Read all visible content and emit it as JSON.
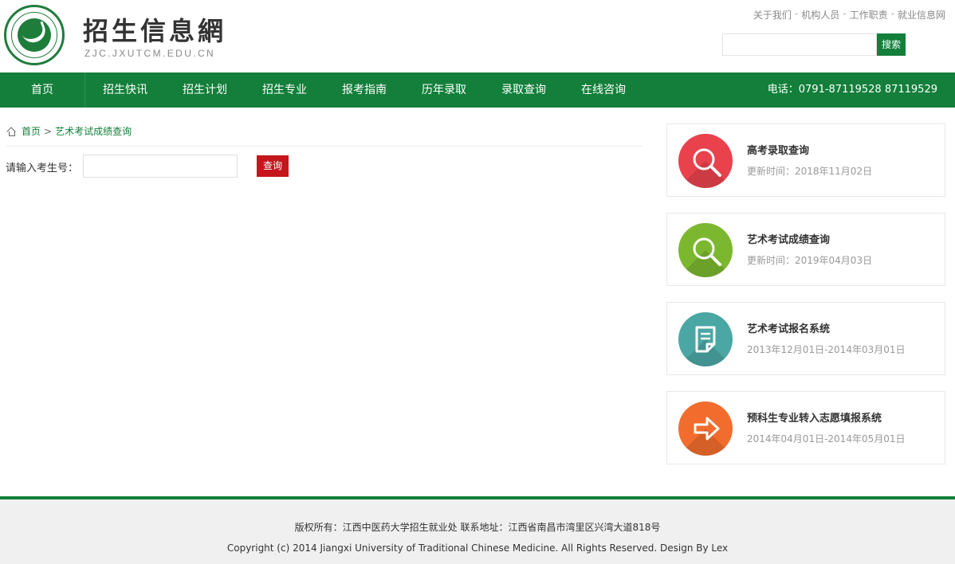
{
  "header": {
    "title": "招生信息網",
    "subtitle": "ZJC.JXUTCM.EDU.CN",
    "top_links": [
      "关于我们",
      "机构人员",
      "工作职责",
      "就业信息网"
    ],
    "top_links_sep": "-",
    "search_button": "搜索"
  },
  "nav": {
    "items": [
      "首页",
      "招生快讯",
      "招生计划",
      "招生专业",
      "报考指南",
      "历年录取",
      "录取查询",
      "在线咨询"
    ],
    "phone": "电话：0791-87119528 87119529"
  },
  "breadcrumb": {
    "home": "首页",
    "sep": ">",
    "current": "艺术考试成绩查询"
  },
  "query": {
    "label": "请输入考生号：",
    "button": "查询",
    "value": ""
  },
  "cards": [
    {
      "title": "高考录取查询",
      "date": "更新时间：2018年11月02日",
      "color": "#e9424d",
      "icon": "search-icon"
    },
    {
      "title": "艺术考试成绩查询",
      "date": "更新时间：2019年04月03日",
      "color": "#7cb82f",
      "icon": "search-icon"
    },
    {
      "title": "艺术考试报名系统",
      "date": "2013年12月01日-2014年03月01日",
      "color": "#4aa7a4",
      "icon": "document-icon"
    },
    {
      "title": "预科生专业转入志愿填报系统",
      "date": "2014年04月01日-2014年05月01日",
      "color": "#f26d2d",
      "icon": "arrow-right-icon"
    }
  ],
  "footer": {
    "line1": "版权所有：江西中医药大学招生就业处 联系地址：江西省南昌市湾里区兴湾大道818号",
    "line2": "Copyright (c) 2014 Jiangxi University of Traditional Chinese Medicine. All Rights Reserved. Design By Lex"
  },
  "colors": {
    "brand_green": "#137f3a",
    "query_red": "#c4161c"
  }
}
